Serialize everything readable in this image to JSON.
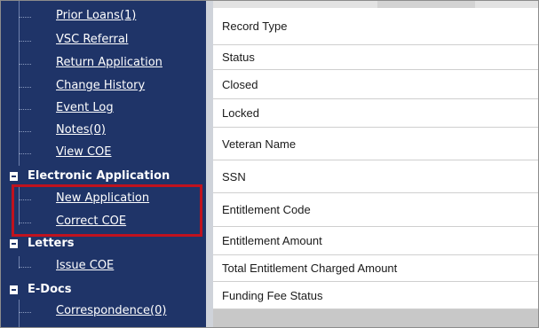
{
  "sidebar": {
    "links_top": [
      {
        "label": "Prior Loans(1)"
      },
      {
        "label": "VSC Referral"
      },
      {
        "label": "Return Application"
      },
      {
        "label": "Change History"
      },
      {
        "label": "Event Log"
      },
      {
        "label": "Notes(0)"
      },
      {
        "label": "View COE"
      }
    ],
    "sections": [
      {
        "label": "Electronic Application",
        "items": [
          {
            "label": "New Application"
          },
          {
            "label": "Correct COE"
          }
        ]
      },
      {
        "label": "Letters",
        "items": [
          {
            "label": "Issue COE"
          }
        ]
      },
      {
        "label": "E-Docs",
        "items": [
          {
            "label": "Correspondence(0)"
          }
        ]
      }
    ]
  },
  "record_fields": [
    {
      "label": "Record Type"
    },
    {
      "label": "Status"
    },
    {
      "label": "Closed"
    },
    {
      "label": "Locked"
    },
    {
      "label": "Veteran Name"
    },
    {
      "label": "SSN"
    },
    {
      "label": "Entitlement Code"
    },
    {
      "label": "Entitlement Amount"
    },
    {
      "label": "Total Entitlement Charged Amount"
    },
    {
      "label": "Funding Fee Status"
    }
  ],
  "colors": {
    "sidebar_bg": "#1f3468",
    "highlight": "#c0121e"
  }
}
